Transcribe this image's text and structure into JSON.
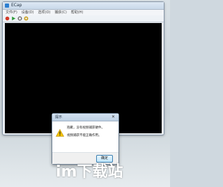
{
  "window": {
    "title": "ECap",
    "menu": [
      "文件(F)",
      "设备(D)",
      "选项(O)",
      "捕获(C)",
      "帮助(H)"
    ],
    "toolbar_icons": [
      "record-icon",
      "play-icon",
      "stop-icon",
      "settings-icon"
    ]
  },
  "dialog": {
    "title": "提示",
    "message_line1": "抱歉，没有视频捕获硬件。",
    "message_line2": "视频捕获不能正确作用。",
    "ok_label": "确定",
    "icon": "warning-icon"
  },
  "watermark": "im下载站",
  "colors": {
    "video_background": "#000000",
    "warning_yellow": "#f5c400",
    "button_border": "#3c7fb1"
  }
}
